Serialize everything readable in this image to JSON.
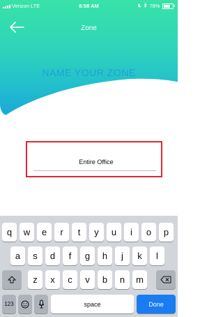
{
  "status_bar": {
    "carrier": "Verizon",
    "network": "LTE",
    "time": "8:58 AM",
    "battery": "78%"
  },
  "nav": {
    "title": "Zone",
    "back_icon": "arrow-left-icon"
  },
  "header": {
    "prompt": "NAME YOUR ZONE"
  },
  "zone_name": {
    "value": "Entire Office"
  },
  "keyboard": {
    "row1": [
      "q",
      "w",
      "e",
      "r",
      "t",
      "y",
      "u",
      "i",
      "o",
      "p"
    ],
    "row2": [
      "a",
      "s",
      "d",
      "f",
      "g",
      "h",
      "j",
      "k",
      "l"
    ],
    "row3": [
      "z",
      "x",
      "c",
      "v",
      "b",
      "n",
      "m"
    ],
    "numbers_label": "123",
    "space_label": "space",
    "done_label": "Done",
    "shift_icon": "shift-icon",
    "delete_icon": "delete-icon",
    "emoji_icon": "emoji-icon",
    "mic_icon": "microphone-icon"
  },
  "colors": {
    "header_top": "#38e2a8",
    "header_bottom": "#1ba8d8",
    "prompt_text": "#1f9bd8",
    "highlight": "#e1262f",
    "done_key": "#1a7cf2"
  }
}
